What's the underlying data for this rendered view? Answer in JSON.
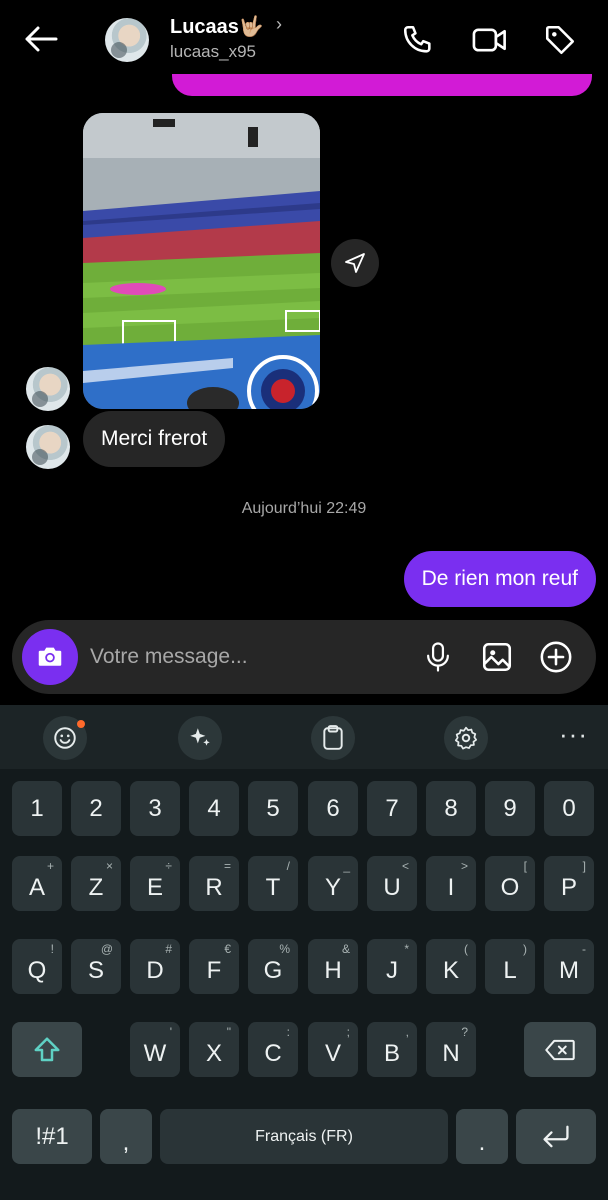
{
  "header": {
    "name": "Lucaas🤟🏼",
    "chevron": "›",
    "handle": "lucaas_x95",
    "icons": [
      "back-arrow-icon",
      "phone-icon",
      "video-camera-icon",
      "tag-icon"
    ]
  },
  "messages": {
    "received_text": "Merci frerot",
    "timestamp": "Aujourd’hui 22:49",
    "sent_text": "De rien mon reuf"
  },
  "composer": {
    "placeholder": "Votre message...",
    "icons": [
      "camera-icon",
      "microphone-icon",
      "gallery-icon",
      "add-icon"
    ]
  },
  "keyboard": {
    "toolbar_icons": [
      "emoji-icon",
      "sparkle-icon",
      "clipboard-icon",
      "settings-icon",
      "more-icon"
    ],
    "more_label": "···",
    "numbers": [
      "1",
      "2",
      "3",
      "4",
      "5",
      "6",
      "7",
      "8",
      "9",
      "0"
    ],
    "row1": [
      {
        "k": "A",
        "s": "+"
      },
      {
        "k": "Z",
        "s": "×"
      },
      {
        "k": "E",
        "s": "÷"
      },
      {
        "k": "R",
        "s": "="
      },
      {
        "k": "T",
        "s": "/"
      },
      {
        "k": "Y",
        "s": "_"
      },
      {
        "k": "U",
        "s": "<"
      },
      {
        "k": "I",
        "s": ">"
      },
      {
        "k": "O",
        "s": "["
      },
      {
        "k": "P",
        "s": "]"
      }
    ],
    "row2": [
      {
        "k": "Q",
        "s": "!"
      },
      {
        "k": "S",
        "s": "@"
      },
      {
        "k": "D",
        "s": "#"
      },
      {
        "k": "F",
        "s": "€"
      },
      {
        "k": "G",
        "s": "%"
      },
      {
        "k": "H",
        "s": "&"
      },
      {
        "k": "J",
        "s": "*"
      },
      {
        "k": "K",
        "s": "("
      },
      {
        "k": "L",
        "s": ")"
      },
      {
        "k": "M",
        "s": "-"
      }
    ],
    "row3": [
      {
        "k": "W",
        "s": "'"
      },
      {
        "k": "X",
        "s": "\""
      },
      {
        "k": "C",
        "s": ":"
      },
      {
        "k": "V",
        "s": ";"
      },
      {
        "k": "B",
        "s": ","
      },
      {
        "k": "N",
        "s": "?"
      }
    ],
    "symbols_key": "!#1",
    "comma_key": ",",
    "space_key": "Français (FR)",
    "period_key": "."
  },
  "colors": {
    "accent_purple": "#7a2ff0",
    "header_strip": "#d21bd6",
    "bubble_received": "#262626",
    "keyboard_bg": "#131a1c",
    "shift_accent": "#5fd1c4"
  }
}
